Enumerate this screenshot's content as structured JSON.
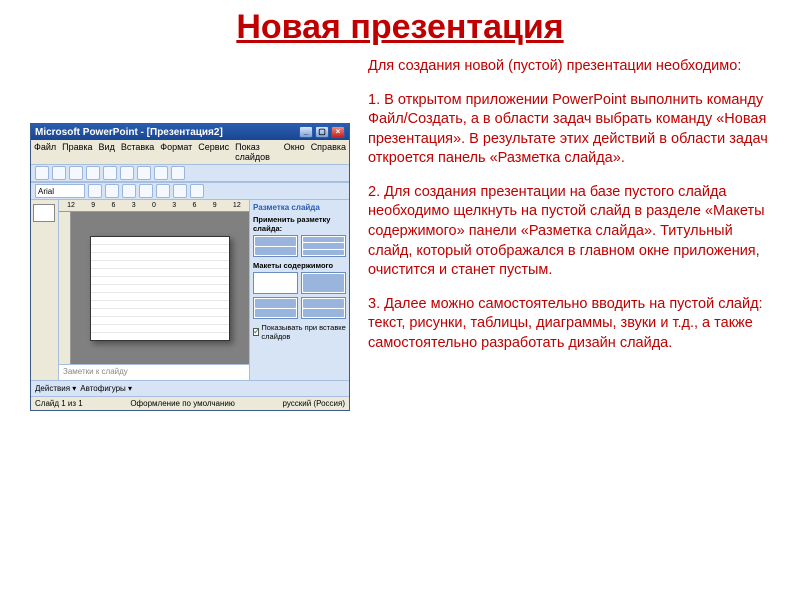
{
  "title": "Новая презентация",
  "intro": "Для создания новой (пустой) презентации необходимо:",
  "step1": "1. В открытом приложении PowerPoint выполнить команду Файл/Создать, а в области задач выбрать команду «Новая презентация». В результате этих действий в области задач откроется панель «Разметка слайда».",
  "step2": "2. Для создания презентации на базе пустого слайда необходимо щелкнуть на пустой слайд в разделе «Макеты содержимого» панели «Разметка слайда». Титульный слайд, который отображался в главном окне приложения, очистится и станет пустым.",
  "step3": "3. Далее можно самостоятельно вводить на пустой слайд: текст, рисунки, таблицы, диаграммы, звуки и т.д., а также самостоятельно разработать дизайн слайда.",
  "ppt": {
    "window_title": "Microsoft PowerPoint - [Презентация2]",
    "menu": [
      "Файл",
      "Правка",
      "Вид",
      "Вставка",
      "Формат",
      "Сервис",
      "Показ слайдов",
      "Окно",
      "Справка"
    ],
    "font": "Arial",
    "ruler": [
      "12",
      "9",
      "6",
      "3",
      "0",
      "3",
      "6",
      "9",
      "12"
    ],
    "taskpane_title": "Разметка слайда",
    "taskpane_apply": "Применить разметку слайда:",
    "taskpane_section": "Макеты содержимого",
    "taskpane_checkbox": "Показывать при вставке слайдов",
    "notes_placeholder": "Заметки к слайду",
    "bottombar": [
      "Действия ▾",
      "Автофигуры ▾"
    ],
    "status_left": "Слайд 1 из 1",
    "status_mid": "Оформление по умолчанию",
    "status_right": "русский (Россия)"
  }
}
